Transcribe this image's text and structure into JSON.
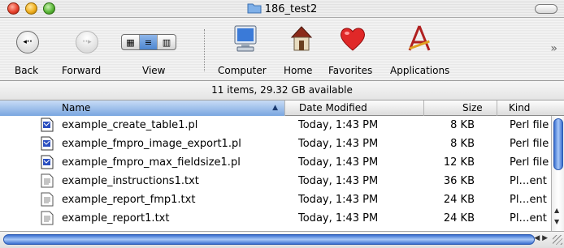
{
  "window": {
    "title": "186_test2"
  },
  "toolbar": {
    "back": "Back",
    "forward": "Forward",
    "view": "View",
    "computer": "Computer",
    "home": "Home",
    "favorites": "Favorites",
    "applications": "Applications",
    "overflow": "»"
  },
  "status": "11 items, 29.32 GB available",
  "columns": {
    "name": "Name",
    "date": "Date Modified",
    "size": "Size",
    "kind": "Kind"
  },
  "files": [
    {
      "name": "example_create_table1.pl",
      "date": "Today, 1:43 PM",
      "size": "8 KB",
      "kind": "Perl file",
      "icon": "perl-file-icon"
    },
    {
      "name": "example_fmpro_image_export1.pl",
      "date": "Today, 1:43 PM",
      "size": "8 KB",
      "kind": "Perl file",
      "icon": "perl-file-icon"
    },
    {
      "name": "example_fmpro_max_fieldsize1.pl",
      "date": "Today, 1:43 PM",
      "size": "12 KB",
      "kind": "Perl file",
      "icon": "perl-file-icon"
    },
    {
      "name": "example_instructions1.txt",
      "date": "Today, 1:43 PM",
      "size": "36 KB",
      "kind": "Pl…ent",
      "icon": "text-file-icon"
    },
    {
      "name": "example_report_fmp1.txt",
      "date": "Today, 1:43 PM",
      "size": "24 KB",
      "kind": "Pl…ent",
      "icon": "text-file-icon"
    },
    {
      "name": "example_report1.txt",
      "date": "Today, 1:43 PM",
      "size": "24 KB",
      "kind": "Pl…ent",
      "icon": "text-file-icon"
    }
  ],
  "colors": {
    "selection_blue": "#3a6fd0",
    "sorted_header": "#7aa6e0"
  }
}
